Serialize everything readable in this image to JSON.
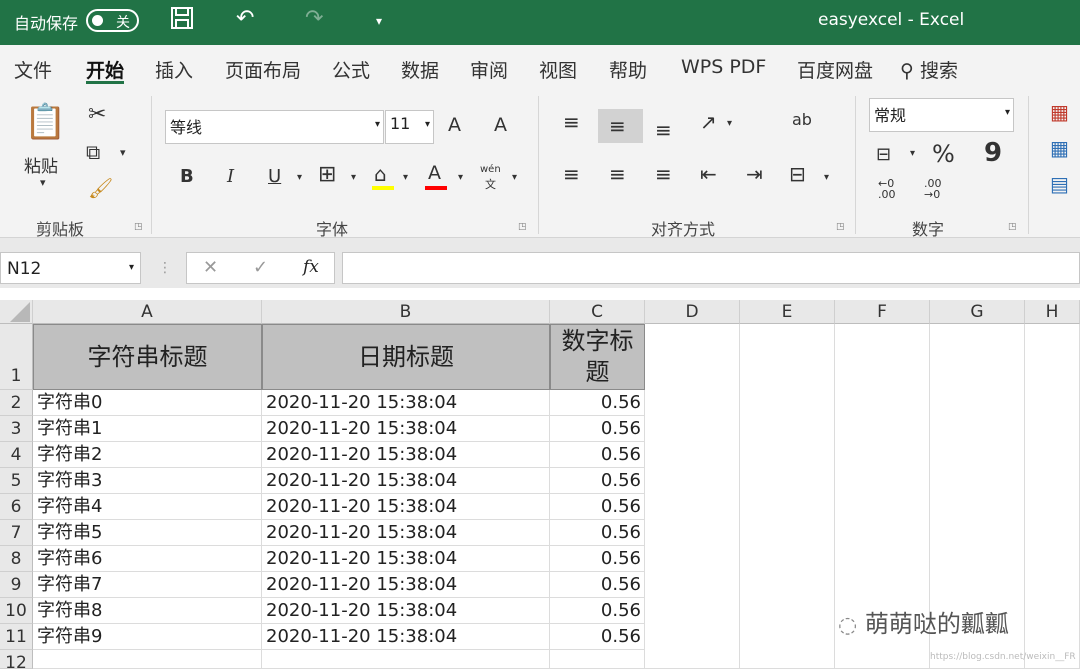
{
  "titlebar": {
    "autosave": "自动保存",
    "toggle": "关",
    "title": "easyexcel  -  Excel"
  },
  "menu": [
    "文件",
    "开始",
    "插入",
    "页面布局",
    "公式",
    "数据",
    "审阅",
    "视图",
    "帮助",
    "WPS PDF",
    "百度网盘",
    "搜索"
  ],
  "clipboard": {
    "paste": "粘贴",
    "group": "剪贴板"
  },
  "font": {
    "name": "等线",
    "size": "11",
    "group": "字体",
    "bold": "B",
    "italic": "I",
    "underline": "U",
    "grow": "A",
    "shrink": "A",
    "color": "A",
    "wen": "wén",
    "wen2": "文"
  },
  "align": {
    "group": "对齐方式",
    "wrap": "ab"
  },
  "number": {
    "format": "常规",
    "group": "数字",
    "percent": "%",
    "comma": "9",
    "inc": "←0 .00",
    "dec": ".00 →0"
  },
  "formula": {
    "cell_ref": "N12",
    "fx": "fx"
  },
  "columns": [
    "A",
    "B",
    "C",
    "D",
    "E",
    "F",
    "G",
    "H"
  ],
  "rows": [
    "1",
    "2",
    "3",
    "4",
    "5",
    "6",
    "7",
    "8",
    "9",
    "10",
    "11",
    "12"
  ],
  "headers": [
    "字符串标题",
    "日期标题",
    "数字标题"
  ],
  "data": [
    [
      "字符串0",
      "2020-11-20 15:38:04",
      "0.56"
    ],
    [
      "字符串1",
      "2020-11-20 15:38:04",
      "0.56"
    ],
    [
      "字符串2",
      "2020-11-20 15:38:04",
      "0.56"
    ],
    [
      "字符串3",
      "2020-11-20 15:38:04",
      "0.56"
    ],
    [
      "字符串4",
      "2020-11-20 15:38:04",
      "0.56"
    ],
    [
      "字符串5",
      "2020-11-20 15:38:04",
      "0.56"
    ],
    [
      "字符串6",
      "2020-11-20 15:38:04",
      "0.56"
    ],
    [
      "字符串7",
      "2020-11-20 15:38:04",
      "0.56"
    ],
    [
      "字符串8",
      "2020-11-20 15:38:04",
      "0.56"
    ],
    [
      "字符串9",
      "2020-11-20 15:38:04",
      "0.56"
    ]
  ],
  "watermark": "萌萌哒的瓤瓤",
  "watermark_url": "https://blog.csdn.net/weixin__FR"
}
